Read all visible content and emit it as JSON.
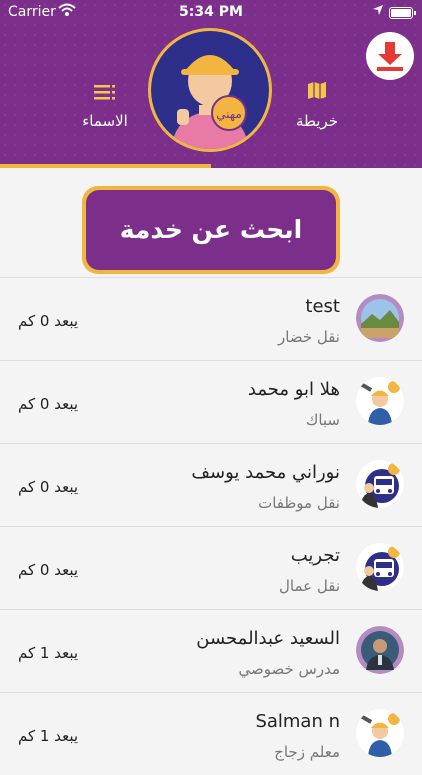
{
  "status": {
    "carrier": "Carrier",
    "time": "5:34 PM"
  },
  "tabs": {
    "names": "الاسماء",
    "map": "خريطة"
  },
  "search_button": "ابحث عن خدمة",
  "workers": [
    {
      "name": "test",
      "job": "نقل خضار",
      "distance": "يبعد 0 كم",
      "avatar": "landscape"
    },
    {
      "name": "هلا ابو محمد",
      "job": "سباك",
      "distance": "يبعد 0 كم",
      "avatar": "plumber"
    },
    {
      "name": "نوراني محمد يوسف",
      "job": "نقل موظفات",
      "distance": "يبعد 0 كم",
      "avatar": "bus"
    },
    {
      "name": "تجريب",
      "job": "نقل عمال",
      "distance": "يبعد 0 كم",
      "avatar": "bus"
    },
    {
      "name": "السعيد عبدالمحسن",
      "job": "مدرس خصوصي",
      "distance": "يبعد 1 كم",
      "avatar": "photo"
    },
    {
      "name": "Salman n",
      "job": "معلم زجاج",
      "distance": "يبعد 1 كم",
      "avatar": "plumber"
    }
  ],
  "colors": {
    "primary": "#7b2f8a",
    "accent": "#f2b640",
    "download": "#e53935"
  }
}
